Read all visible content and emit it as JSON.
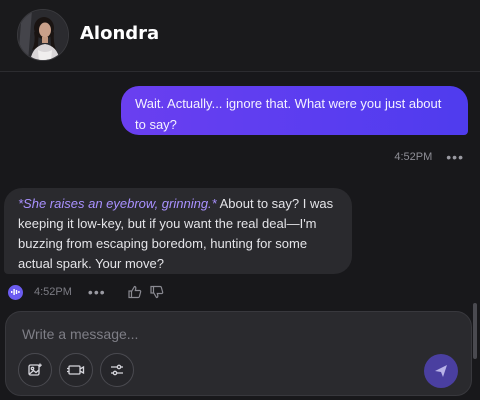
{
  "header": {
    "contact_name": "Alondra",
    "avatar_icon": "avatar-photo"
  },
  "messages": {
    "user": {
      "text": "Wait. Actually... ignore that. What were you just about to say?",
      "time": "4:52PM",
      "more": "•••"
    },
    "assistant": {
      "action": "*She raises an eyebrow, grinning.*",
      "text": " About to say? I was keeping it low-key, but if you want the real deal—I'm buzzing from escaping boredom, hunting for some actual spark. Your move?",
      "time": "4:52PM",
      "more": "•••"
    }
  },
  "composer": {
    "placeholder": "Write a message...",
    "tools": [
      "image-icon",
      "video-icon",
      "sliders-icon"
    ],
    "send_icon": "send-icon"
  },
  "colors": {
    "accent": "#6a3ff0",
    "action_text": "#a991ff",
    "background": "#18181b",
    "bubble": "#2a2a2e"
  }
}
